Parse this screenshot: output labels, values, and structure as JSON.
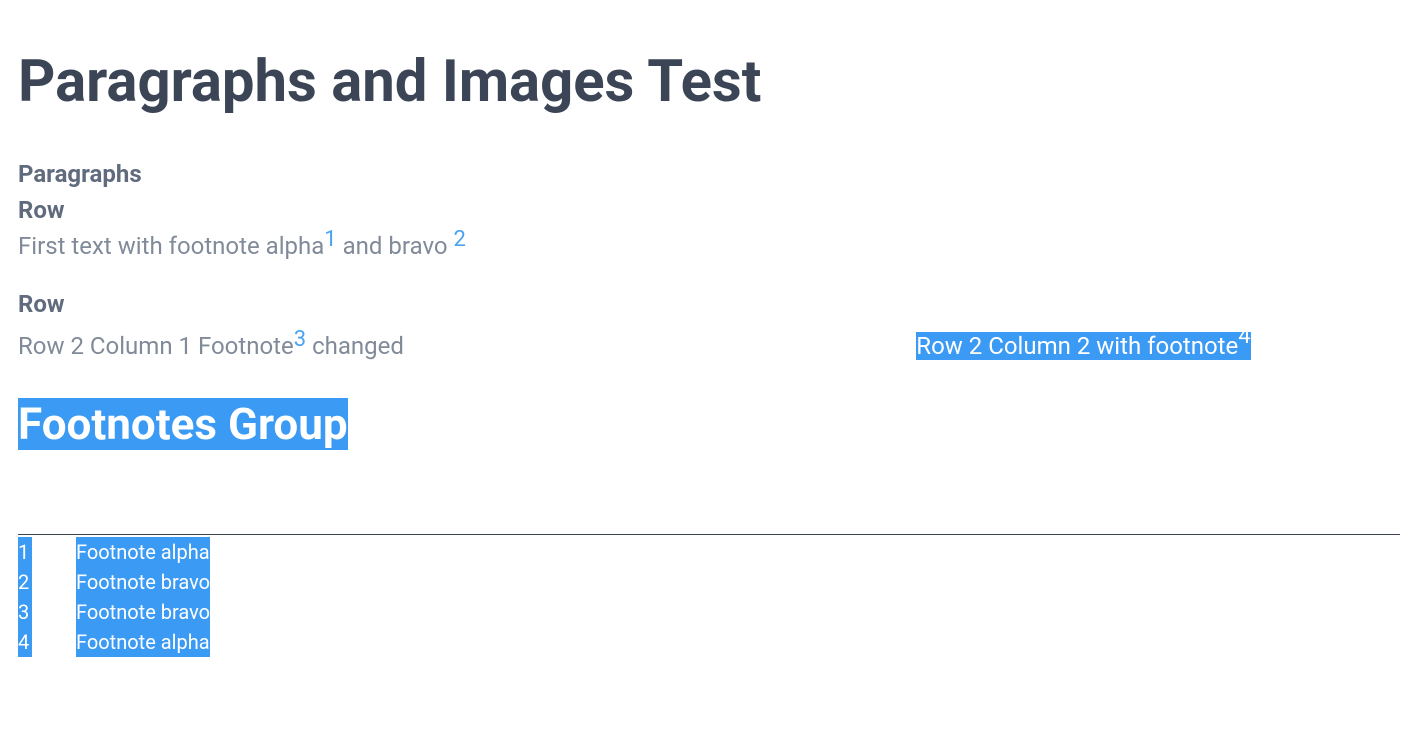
{
  "title": "Paragraphs and Images Test",
  "sections": {
    "paragraphs_label": "Paragraphs",
    "row_label": "Row"
  },
  "row1": {
    "text_a": "First text with footnote alpha",
    "ref1": "1",
    "text_b": "  and bravo ",
    "ref2": "2"
  },
  "row2": {
    "col1_text_a": "Row 2 Column 1 Footnote",
    "col1_ref": "3",
    "col1_text_b": "  changed",
    "col2_text": "Row 2 Column 2 with footnote",
    "col2_ref": "4"
  },
  "footnotes_group_heading": "Footnotes Group",
  "footnotes": [
    {
      "num": "1",
      "text": "Footnote alpha"
    },
    {
      "num": "2",
      "text": "Footnote bravo"
    },
    {
      "num": "3",
      "text": "Footnote bravo"
    },
    {
      "num": "4",
      "text": "Footnote alpha"
    }
  ]
}
